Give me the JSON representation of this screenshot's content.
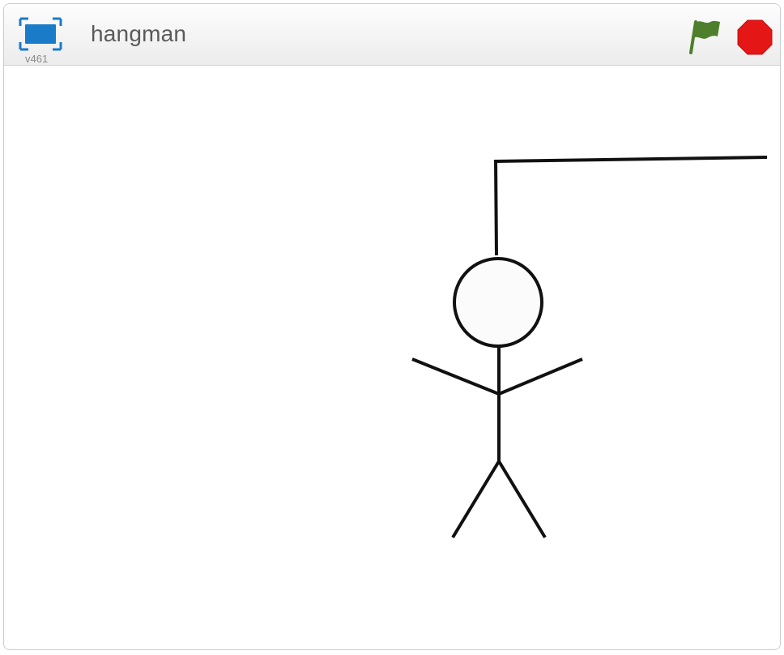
{
  "player": {
    "title": "hangman",
    "version": "v461"
  },
  "controls": {
    "fullscreen_icon": "fullscreen-icon",
    "green_flag_icon": "green-flag-icon",
    "stop_icon": "stop-sign-icon"
  },
  "colors": {
    "fullscreen_blue": "#1a7bc9",
    "flag_green": "#4d7f2c",
    "stop_red": "#e51616",
    "drawing_stroke": "#111111",
    "head_fill": "#fbfbfb"
  },
  "stage": {
    "drawing": "hangman-figure"
  }
}
